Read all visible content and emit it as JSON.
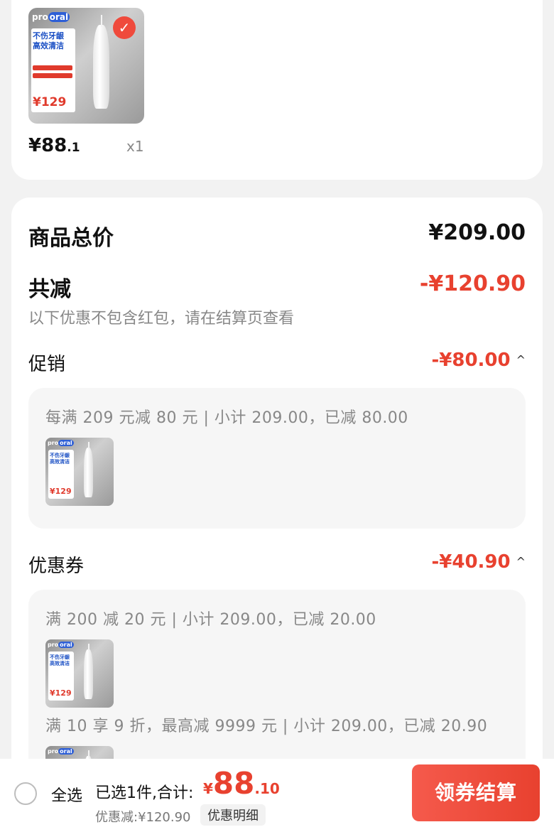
{
  "product": {
    "thumb_brand": "pro",
    "thumb_brand_tag": "oral",
    "thumb_headline": "不伤牙龈\n高效清洁",
    "thumb_price": "¥129",
    "price_int": "¥88",
    "price_dec": ".1",
    "qty": "x1",
    "selected": true
  },
  "summary": {
    "total_label": "商品总价",
    "total_value": "¥209.00",
    "reduce_label": "共减",
    "reduce_value": "-¥120.90",
    "note": "以下优惠不包含红包，请在结算页查看",
    "promo_label": "促销",
    "promo_value": "-¥80.00",
    "promo_line": "每满 209 元减 80 元 | 小计 209.00，已减 80.00",
    "coupon_label": "优惠券",
    "coupon_value": "-¥40.90",
    "coupon_line1": "满 200 减 20 元 | 小计 209.00，已减 20.00",
    "coupon_line2": "满 10 享 9 折，最高减 9999 元 | 小计 209.00，已减 20.90",
    "caret": "^"
  },
  "bottom": {
    "select_all": "全选",
    "selected_count": "已选1件,合计:",
    "total_yen": "¥",
    "total_int": "88",
    "total_dec": ".10",
    "discount": "优惠减:¥120.90",
    "detail_btn": "优惠明细",
    "checkout_btn": "领券结算"
  },
  "colors": {
    "accent": "#e8412f",
    "background": "#f2f2f2"
  },
  "icons": {
    "check": "checkmark-icon",
    "caret": "caret-up-icon",
    "radio": "radio-icon"
  }
}
